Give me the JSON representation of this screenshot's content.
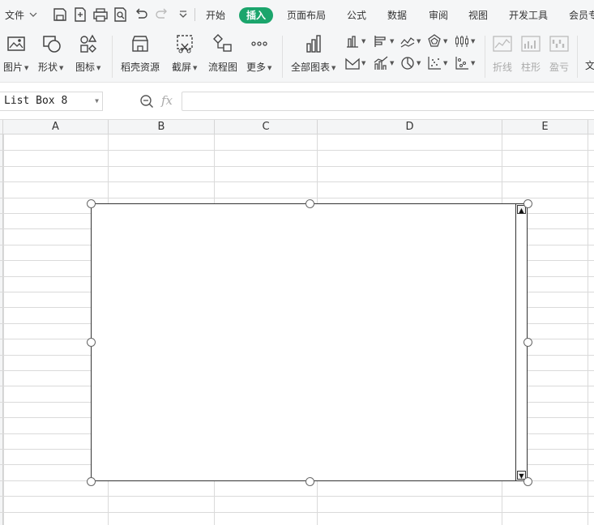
{
  "menu": {
    "file_label": "文件",
    "tabs": [
      "开始",
      "插入",
      "页面布局",
      "公式",
      "数据",
      "审阅",
      "视图",
      "开发工具",
      "会员专"
    ],
    "active_tab": "插入"
  },
  "ribbon": {
    "picture": "图片",
    "shape": "形状",
    "icon": "图标",
    "resources": "稻壳资源",
    "screenshot": "截屏",
    "flowchart": "流程图",
    "more": "更多",
    "all_charts": "全部图表",
    "sparkline_line": "折线",
    "sparkline_column": "柱形",
    "sparkline_winloss": "盈亏",
    "text_partial": "文"
  },
  "formula_bar": {
    "name_box": "List Box 8",
    "fx_label": "fx",
    "formula_value": ""
  },
  "columns": [
    "A",
    "B",
    "C",
    "D",
    "E"
  ],
  "colors": {
    "accent": "#1ba56c",
    "toolbar_bg": "#f5f6f7",
    "grid_line": "#dadada"
  }
}
